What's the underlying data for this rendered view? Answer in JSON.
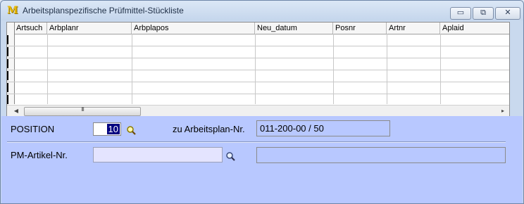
{
  "window": {
    "title": "Arbeitsplanspezifische Prüfmittel-Stückliste",
    "app_icon": "M",
    "controls": {
      "minimize": "▭",
      "maximize": "⧉",
      "close": "✕"
    }
  },
  "grid": {
    "columns": [
      "Artsuch",
      "Arbplanr",
      "Arbplapos",
      "Neu_datum",
      "Posnr",
      "Artnr",
      "Aplaid"
    ],
    "rows": [],
    "scroll_left": "◀",
    "scroll_right": "▸",
    "thumb_grip": "III"
  },
  "form": {
    "position_label": "POSITION",
    "position_value": "10",
    "arbeitsplan_label": "zu Arbeitsplan-Nr.",
    "arbeitsplan_value": "011-200-00 / 50",
    "pm_artikel_label": "PM-Artikel-Nr.",
    "pm_artikel_value": "",
    "pm_artikel_description": ""
  },
  "icons": {
    "lookup": "magnifier-icon"
  }
}
